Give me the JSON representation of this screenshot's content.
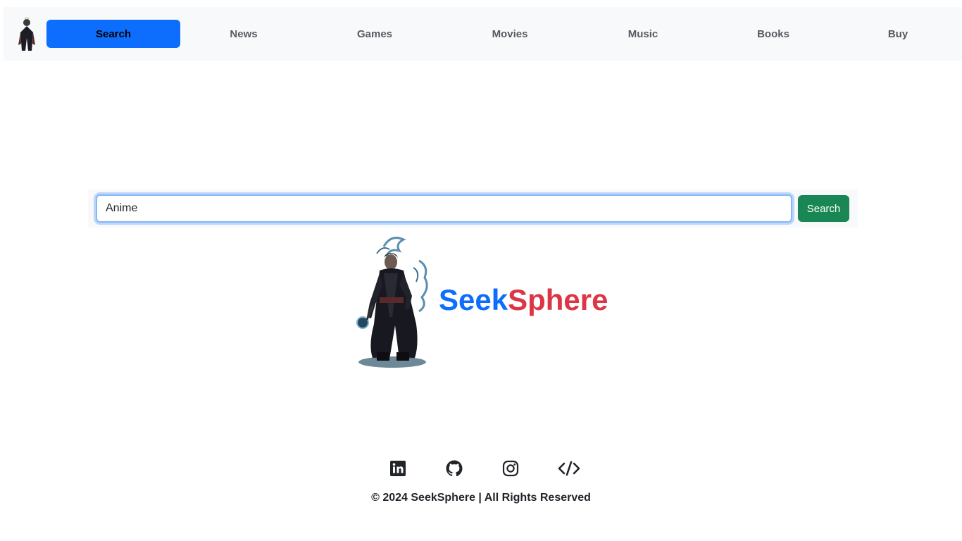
{
  "nav": {
    "items": [
      {
        "label": "Search",
        "active": true
      },
      {
        "label": "News"
      },
      {
        "label": "Games"
      },
      {
        "label": "Movies"
      },
      {
        "label": "Music"
      },
      {
        "label": "Books"
      },
      {
        "label": "Buy"
      }
    ],
    "logo_icon": "character-logo-icon",
    "active_color": "#0d6efd"
  },
  "search": {
    "value": "Anime",
    "button_label": "Search",
    "button_color": "#198754"
  },
  "brand": {
    "part1": "Seek",
    "part2": "Sphere",
    "part1_color": "#0d6efd",
    "part2_color": "#dc3545"
  },
  "social": [
    {
      "icon": "linkedin-icon"
    },
    {
      "icon": "github-icon"
    },
    {
      "icon": "instagram-icon"
    },
    {
      "icon": "code-icon"
    }
  ],
  "footer": {
    "text": "© 2024 SeekSphere | All Rights Reserved"
  }
}
